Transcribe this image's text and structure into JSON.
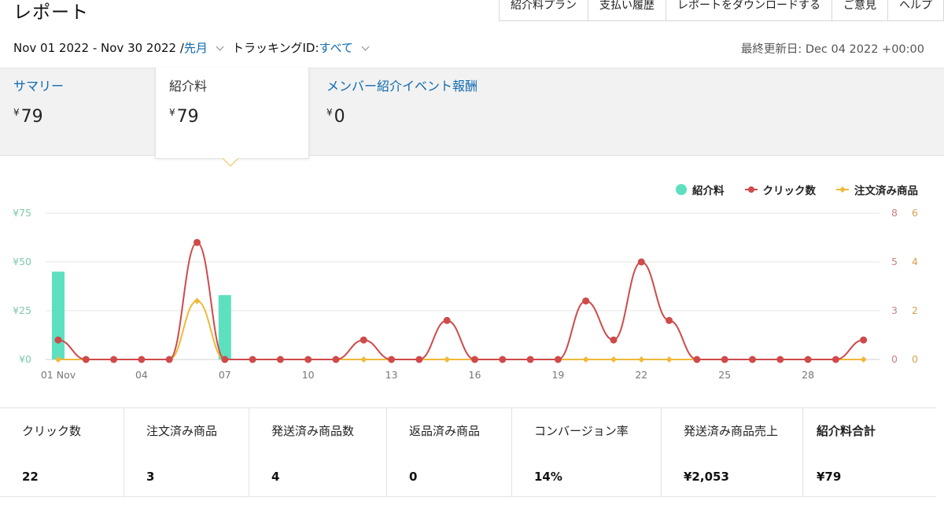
{
  "header": {
    "title": "レポート",
    "nav": [
      "紹介料プラン",
      "支払い履歴",
      "レポートをダウンロードする",
      "ご意見",
      "ヘルプ"
    ]
  },
  "filters": {
    "date_range": "Nov 01 2022 - Nov 30 2022 / ",
    "period": "先月",
    "tracking_label": "トラッキングID: ",
    "tracking_value": "すべて",
    "updated": "最終更新日: Dec 04 2022 +00:00"
  },
  "tabs": [
    {
      "label": "サマリー",
      "value": "79",
      "currency": "¥"
    },
    {
      "label": "紹介料",
      "value": "79",
      "currency": "¥"
    },
    {
      "label": "メンバー紹介イベント報酬",
      "value": "0",
      "currency": "¥"
    }
  ],
  "colors": {
    "fee": "#5ce0c0",
    "clicks": "#cf4a4a",
    "orders": "#f0b93a",
    "link": "#0f6ab0"
  },
  "legend": [
    "紹介料",
    "クリック数",
    "注文済み商品"
  ],
  "chart_data": {
    "type": "bar+line",
    "x": [
      "01 Nov",
      "02",
      "03",
      "04",
      "05",
      "06",
      "07",
      "08",
      "09",
      "10",
      "11",
      "12",
      "13",
      "14",
      "15",
      "16",
      "17",
      "18",
      "19",
      "20",
      "21",
      "22",
      "23",
      "24",
      "25",
      "26",
      "27",
      "28",
      "29",
      "30"
    ],
    "x_tick_labels": {
      "0": "01 Nov",
      "3": "04",
      "6": "07",
      "9": "10",
      "12": "13",
      "15": "16",
      "18": "19",
      "21": "22",
      "24": "25",
      "27": "28"
    },
    "series": [
      {
        "name": "紹介料",
        "type": "bar",
        "axis": "left",
        "values": [
          45,
          0,
          0,
          0,
          0,
          0,
          33,
          0,
          0,
          0,
          0,
          0,
          0,
          0,
          0,
          0,
          0,
          0,
          0,
          0,
          0,
          0,
          0,
          0,
          0,
          0,
          0,
          0,
          0,
          0
        ]
      },
      {
        "name": "クリック数",
        "type": "line",
        "axis": "right1",
        "values": [
          1,
          0,
          0,
          0,
          0,
          6,
          0,
          0,
          0,
          0,
          0,
          1,
          0,
          0,
          2,
          0,
          0,
          0,
          0,
          3,
          1,
          5,
          2,
          0,
          0,
          0,
          0,
          0,
          0,
          1
        ]
      },
      {
        "name": "注文済み商品",
        "type": "line",
        "axis": "right2",
        "values": [
          0,
          0,
          0,
          0,
          0,
          2.4,
          0,
          0,
          0,
          0,
          0,
          0,
          0,
          0,
          0,
          0,
          0,
          0,
          0,
          0,
          0,
          0,
          0,
          0,
          0,
          0,
          0,
          0,
          0,
          0
        ]
      }
    ],
    "axes": {
      "left": {
        "ticks": [
          "¥0",
          "¥25",
          "¥50",
          "¥75"
        ],
        "range": [
          0,
          75
        ]
      },
      "right1": {
        "ticks": [
          "0",
          "3",
          "5",
          "8"
        ],
        "range": [
          0,
          7.5
        ]
      },
      "right2": {
        "ticks": [
          "0",
          "2",
          "4",
          "6"
        ],
        "range": [
          0,
          6
        ]
      }
    },
    "grid": true
  },
  "stats": [
    {
      "label": "クリック数",
      "value": "22"
    },
    {
      "label": "注文済み商品",
      "value": "3"
    },
    {
      "label": "発送済み商品数",
      "value": "4"
    },
    {
      "label": "返品済み商品",
      "value": "0"
    },
    {
      "label": "コンバージョン率",
      "value": "14%"
    },
    {
      "label": "発送済み商品売上",
      "value": "¥2,053"
    },
    {
      "label": "紹介料合計",
      "value": "¥79"
    }
  ]
}
